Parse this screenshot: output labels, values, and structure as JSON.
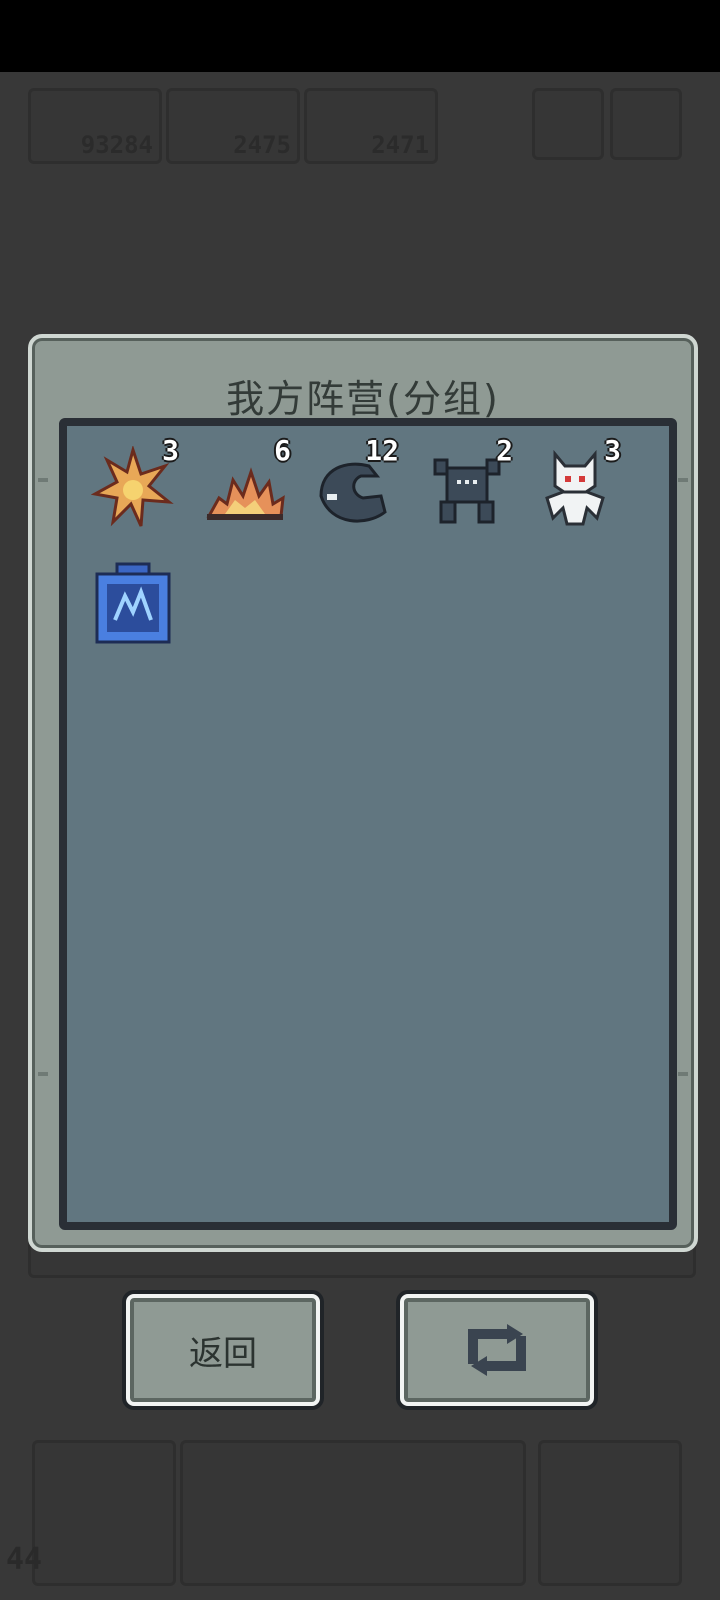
{
  "background": {
    "resources": [
      {
        "icon": "wood-icon",
        "value": "93284"
      },
      {
        "icon": "stone-icon",
        "value": "2475"
      },
      {
        "icon": "iron-icon",
        "value": "2471"
      }
    ],
    "corner_number": "44"
  },
  "dialog": {
    "title": "我方阵营(分组)",
    "units": [
      {
        "icon": "flame-burst-unit-icon",
        "count": "3"
      },
      {
        "icon": "fire-flower-unit-icon",
        "count": "6"
      },
      {
        "icon": "dark-blob-unit-icon",
        "count": "12"
      },
      {
        "icon": "shadow-beast-unit-icon",
        "count": "2"
      },
      {
        "icon": "white-fox-unit-icon",
        "count": "3"
      },
      {
        "icon": "blue-rune-box-icon",
        "count": ""
      }
    ]
  },
  "buttons": {
    "back_label": "返回",
    "swap_icon": "swap-icon"
  },
  "colors": {
    "panel": "#8f9a94",
    "grid": "#617680",
    "frame": "#2a2f36"
  }
}
